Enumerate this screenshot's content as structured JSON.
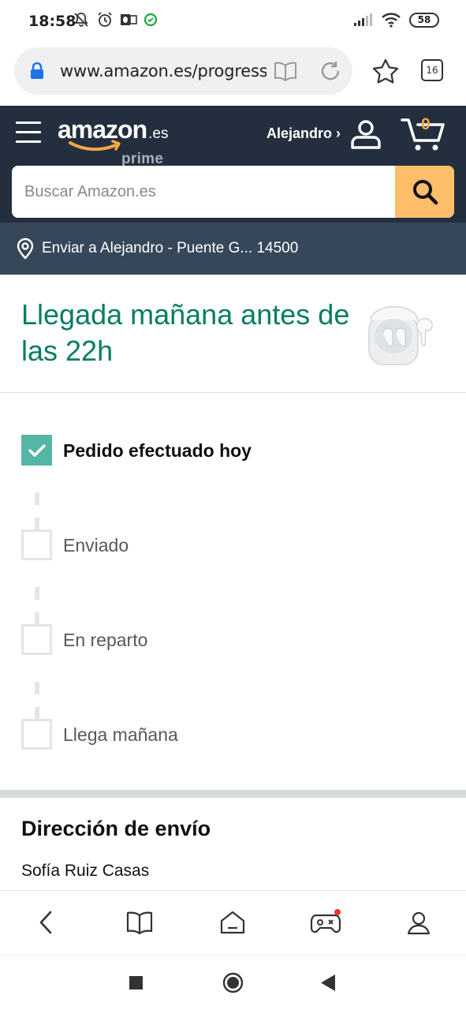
{
  "status_bar": {
    "time": "18:58",
    "battery": "58",
    "icons_left": [
      "mute-icon",
      "alarm-icon",
      "outlook-icon",
      "sync-icon"
    ],
    "icons_right": [
      "signal-icon",
      "wifi-icon",
      "battery-icon"
    ]
  },
  "browser": {
    "url": "www.amazon.es/progress-tracker",
    "tab_count": "16"
  },
  "header": {
    "logo_main": "amazon",
    "logo_suffix": ".es",
    "logo_sub": "prime",
    "account_name": "Alejandro ›",
    "cart_count": "0"
  },
  "search": {
    "placeholder": "Buscar Amazon.es"
  },
  "deliver_to": {
    "text": "Enviar a Alejandro - Puente G... 14500"
  },
  "arrival": {
    "title": "Llegada mañana antes de las 22h"
  },
  "progress": {
    "steps": [
      {
        "label": "Pedido efectuado hoy",
        "done": true
      },
      {
        "label": "Enviado",
        "done": false
      },
      {
        "label": "En reparto",
        "done": false
      },
      {
        "label": "Llega mañana",
        "done": false
      }
    ]
  },
  "shipping_address": {
    "title": "Dirección de envío",
    "name": "Sofía Ruiz Casas"
  },
  "colors": {
    "header_bg": "#232f3e",
    "deliver_bg": "#37475a",
    "search_btn": "#febd69",
    "accent_teal": "#067d62",
    "check_done": "#56b6a6",
    "cart_orange": "#f3a847"
  }
}
